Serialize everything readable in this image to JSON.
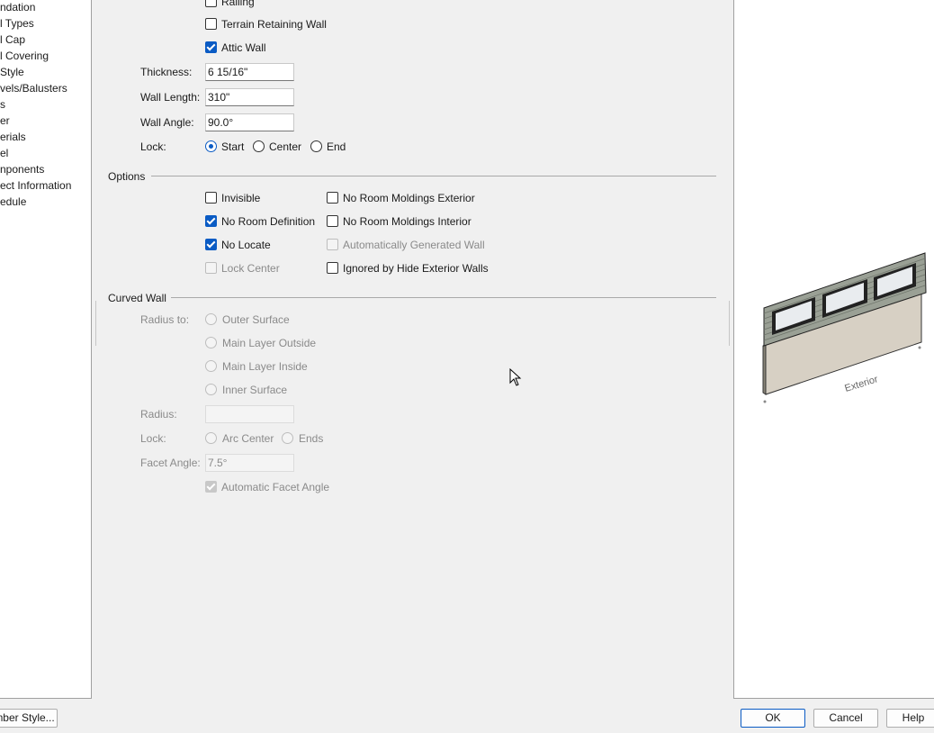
{
  "sidebar": {
    "items": [
      "ndation",
      "l Types",
      "l Cap",
      "l Covering",
      "Style",
      "vels/Balusters",
      "s",
      "er",
      "erials",
      "el",
      "nponents",
      "ect Information",
      "edule"
    ]
  },
  "general": {
    "railing_label": "Railing",
    "terrain_label": "Terrain Retaining Wall",
    "attic_label": "Attic Wall",
    "thickness_label": "Thickness:",
    "thickness_value": "6 15/16\"",
    "length_label": "Wall Length:",
    "length_value": "310\"",
    "angle_label": "Wall Angle:",
    "angle_value": "90.0°",
    "lock_label": "Lock:",
    "lock_start": "Start",
    "lock_center": "Center",
    "lock_end": "End"
  },
  "options": {
    "title": "Options",
    "invisible": "Invisible",
    "no_room_def": "No Room Definition",
    "no_locate": "No Locate",
    "lock_center": "Lock Center",
    "moldings_ext": "No Room Moldings Exterior",
    "moldings_int": "No Room Moldings Interior",
    "auto_gen": "Automatically Generated Wall",
    "ignored_hide": "Ignored by Hide Exterior Walls"
  },
  "curved": {
    "title": "Curved Wall",
    "radius_to_label": "Radius to:",
    "outer_surface": "Outer Surface",
    "main_outside": "Main Layer Outside",
    "main_inside": "Main Layer Inside",
    "inner_surface": "Inner Surface",
    "radius_label": "Radius:",
    "radius_value": "",
    "lock_label": "Lock:",
    "arc_center": "Arc Center",
    "ends": "Ends",
    "facet_label": "Facet Angle:",
    "facet_value": "7.5°",
    "auto_facet": "Automatic Facet Angle"
  },
  "preview": {
    "exterior_label": "Exterior"
  },
  "footer": {
    "member_style": "mber Style...",
    "ok": "OK",
    "cancel": "Cancel",
    "help": "Help"
  },
  "colors": {
    "accent": "#0a5bc4",
    "background": "#f0f0f0"
  }
}
